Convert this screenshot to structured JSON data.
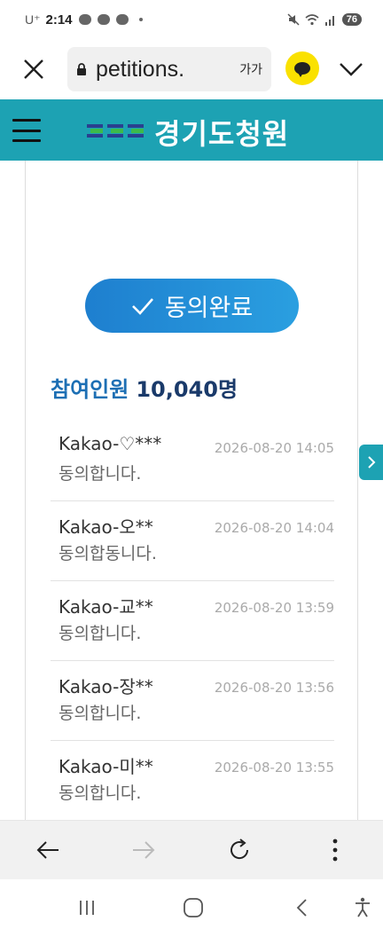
{
  "status_bar": {
    "carrier": "U⁺",
    "time": "2:14",
    "battery": "76"
  },
  "browser": {
    "url": "petitions.",
    "text_size_label": "가가",
    "close_icon": "close-icon",
    "talk_icon": "kakaotalk-icon",
    "menu_icon": "chevron-down-icon"
  },
  "site_header": {
    "logo_text": "경기도청원",
    "menu_icon": "hamburger-icon",
    "color": "#1da2b3"
  },
  "agree_button": {
    "label": "동의완료",
    "icon": "check-icon"
  },
  "participants": {
    "label": "참여인원",
    "count": "10,040명"
  },
  "entries": [
    {
      "name": "Kakao-♡***",
      "date": "2026-08-20 14:05",
      "message": "동의합니다."
    },
    {
      "name": "Kakao-오**",
      "date": "2026-08-20 14:04",
      "message": "동의합동니다."
    },
    {
      "name": "Kakao-교**",
      "date": "2026-08-20 13:59",
      "message": "동의합니다."
    },
    {
      "name": "Kakao-장**",
      "date": "2026-08-20 13:56",
      "message": "동의합니다."
    },
    {
      "name": "Kakao-미**",
      "date": "2026-08-20 13:55",
      "message": "동의합니다."
    }
  ],
  "bottom_nav": [
    "back-arrow-icon",
    "forward-arrow-icon",
    "refresh-icon",
    "more-vert-icon"
  ],
  "system_nav": [
    "recents-icon",
    "home-icon",
    "back-icon",
    "accessibility-icon"
  ]
}
